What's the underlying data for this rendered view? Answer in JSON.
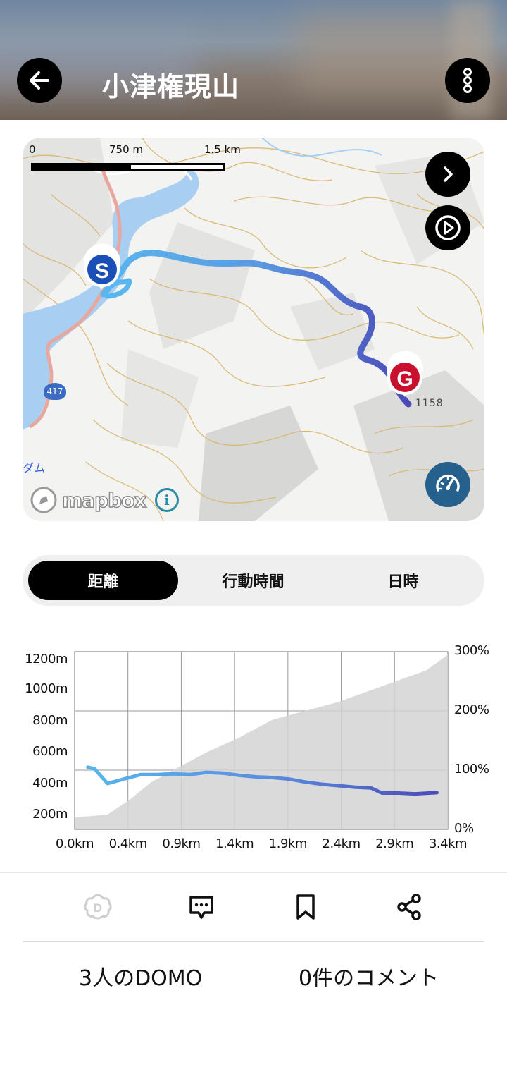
{
  "header": {
    "title": "小津権現山",
    "back_icon": "arrow-left-icon",
    "menu_icon": "more-vertical-icon"
  },
  "map": {
    "scale_labels": [
      "0",
      "750 m",
      "1.5 km"
    ],
    "road_number": "417",
    "place_label": "ダム",
    "elevation_label": "1158",
    "start_marker": "S",
    "goal_marker": "G",
    "attribution": "mapbox",
    "info_label": "i",
    "buttons": [
      "chevron-right-icon",
      "play-icon",
      "speedometer-icon"
    ]
  },
  "tabs": {
    "items": [
      "距離",
      "行動時間",
      "日時"
    ],
    "selected": "距離"
  },
  "chart_data": {
    "type": "line",
    "xlabel": "",
    "ylabel": "",
    "x_ticks": [
      "0.0km",
      "0.4km",
      "0.9km",
      "1.4km",
      "1.9km",
      "2.4km",
      "2.9km",
      "3.4km"
    ],
    "y_left_ticks": [
      "1200m",
      "1000m",
      "800m",
      "600m",
      "400m",
      "200m"
    ],
    "y_right_ticks": [
      "300%",
      "200%",
      "100%",
      "0%"
    ],
    "x_range": [
      0,
      3.4
    ],
    "y_left_range": [
      100,
      1300
    ],
    "y_right_range": [
      0,
      300
    ],
    "grid": true,
    "series": [
      {
        "axis": "left",
        "x": [
          0.12,
          0.18,
          0.3,
          0.45,
          0.6,
          0.75,
          0.9,
          1.05,
          1.2,
          1.35,
          1.5,
          1.65,
          1.8,
          1.95,
          2.1,
          2.25,
          2.4,
          2.55,
          2.7,
          2.8,
          2.95,
          3.1,
          3.3
        ],
        "y": [
          520,
          510,
          410,
          440,
          470,
          470,
          475,
          470,
          485,
          480,
          465,
          455,
          450,
          440,
          420,
          405,
          395,
          385,
          380,
          345,
          345,
          340,
          348
        ]
      },
      {
        "axis": "right",
        "x": [
          0.0,
          0.3,
          0.5,
          0.7,
          1.0,
          1.2,
          1.5,
          1.8,
          2.1,
          2.4,
          2.7,
          3.0,
          3.2,
          3.4
        ],
        "y": [
          20,
          25,
          50,
          80,
          110,
          130,
          155,
          185,
          200,
          215,
          235,
          255,
          268,
          295
        ]
      }
    ]
  },
  "actions": {
    "icons": [
      "domo-icon",
      "comment-icon",
      "bookmark-icon",
      "share-icon"
    ],
    "domo_count_text": "3人のDOMO",
    "comment_count_text": "0件のコメント"
  },
  "colors": {
    "route_start": "#5ab6ee",
    "route_end": "#4a4ab8",
    "start_marker": "#1a4fb8",
    "goal_marker": "#c8102e",
    "speed_button": "#25618c"
  }
}
